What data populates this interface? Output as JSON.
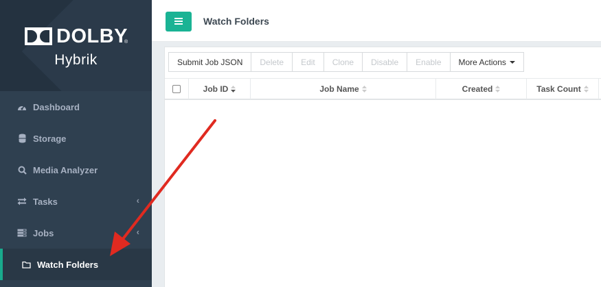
{
  "brand": {
    "logo_text": "DOLBY",
    "registered": "®",
    "product": "Hybrik"
  },
  "nav": {
    "items": [
      {
        "label": "Dashboard",
        "icon": "dashboard-icon",
        "has_chevron": false
      },
      {
        "label": "Storage",
        "icon": "database-icon",
        "has_chevron": false
      },
      {
        "label": "Media Analyzer",
        "icon": "search-icon",
        "has_chevron": false
      },
      {
        "label": "Tasks",
        "icon": "exchange-icon",
        "has_chevron": true
      },
      {
        "label": "Jobs",
        "icon": "tasks-list-icon",
        "has_chevron": true
      },
      {
        "label": "Watch Folders",
        "icon": "folder-icon",
        "has_chevron": false,
        "active": true
      }
    ],
    "chevron": "‹"
  },
  "header": {
    "menu_icon": "hamburger-icon",
    "title": "Watch Folders"
  },
  "toolbar": {
    "buttons": [
      {
        "label": "Submit Job JSON",
        "enabled": true
      },
      {
        "label": "Delete",
        "enabled": false
      },
      {
        "label": "Edit",
        "enabled": false
      },
      {
        "label": "Clone",
        "enabled": false
      },
      {
        "label": "Disable",
        "enabled": false
      },
      {
        "label": "Enable",
        "enabled": false
      },
      {
        "label": "More Actions",
        "enabled": true,
        "dropdown": true
      }
    ]
  },
  "table": {
    "columns": [
      "Job ID",
      "Job Name",
      "Created",
      "Task Count"
    ],
    "sorted_column": "Job ID",
    "rows": []
  },
  "colors": {
    "sidebar": "#2f4050",
    "accent": "#1ab394",
    "annotation_arrow": "#e02a20"
  }
}
